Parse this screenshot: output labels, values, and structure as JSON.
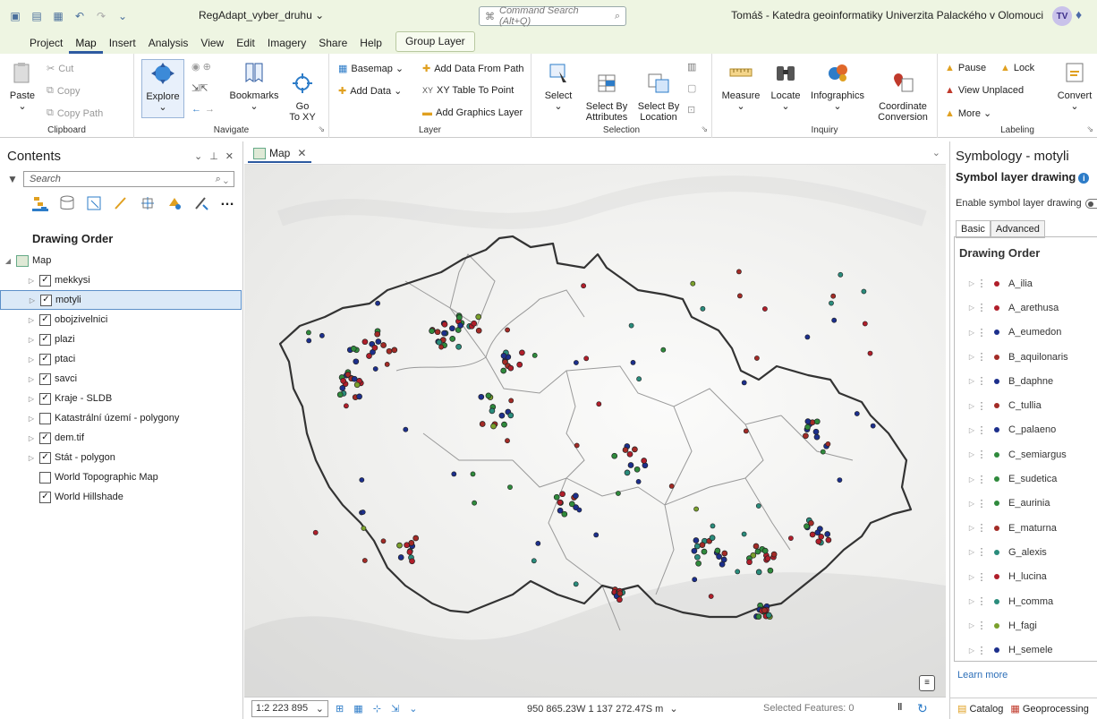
{
  "titlebar": {
    "doc_title": "RegAdapt_vyber_druhu ⌄",
    "command_search_placeholder": "Command Search (Alt+Q)",
    "user": "Tomáš - Katedra geoinformatiky Univerzita Palackého v Olomouci",
    "avatar": "TV"
  },
  "ribbon_tabs": [
    "Project",
    "Map",
    "Insert",
    "Analysis",
    "View",
    "Edit",
    "Imagery",
    "Share",
    "Help"
  ],
  "ribbon_context_tab": "Group Layer",
  "ribbon": {
    "clipboard": {
      "label": "Clipboard",
      "paste": "Paste",
      "cut": "Cut",
      "copy": "Copy",
      "copy_path": "Copy Path"
    },
    "navigate": {
      "label": "Navigate",
      "explore": "Explore",
      "bookmarks": "Bookmarks",
      "go_to_xy": "Go\nTo XY"
    },
    "layer": {
      "label": "Layer",
      "basemap": "Basemap ⌄",
      "add_data": "Add Data ⌄",
      "add_data_from_path": "Add Data From Path",
      "xy_table_to_point": "XY Table To Point",
      "add_graphics_layer": "Add Graphics Layer"
    },
    "selection": {
      "label": "Selection",
      "select": "Select",
      "select_by_attributes": "Select By\nAttributes",
      "select_by_location": "Select By\nLocation"
    },
    "inquiry": {
      "label": "Inquiry",
      "measure": "Measure",
      "locate": "Locate",
      "infographics": "Infographics",
      "coordinate_conversion": "Coordinate\nConversion"
    },
    "labeling": {
      "label": "Labeling",
      "pause": "Pause",
      "lock": "Lock",
      "view_unplaced": "View Unplaced",
      "more": "More ⌄",
      "convert": "Convert"
    }
  },
  "contents": {
    "title": "Contents",
    "search_placeholder": "Search",
    "section": "Drawing Order",
    "map_label": "Map",
    "layers": [
      {
        "name": "mekkysi",
        "checked": true,
        "expandable": true,
        "selected": false
      },
      {
        "name": "motyli",
        "checked": true,
        "expandable": true,
        "selected": true
      },
      {
        "name": "obojzivelnici",
        "checked": true,
        "expandable": true,
        "selected": false
      },
      {
        "name": "plazi",
        "checked": true,
        "expandable": true,
        "selected": false
      },
      {
        "name": "ptaci",
        "checked": true,
        "expandable": true,
        "selected": false
      },
      {
        "name": "savci",
        "checked": true,
        "expandable": true,
        "selected": false
      },
      {
        "name": "Kraje - SLDB",
        "checked": true,
        "expandable": true,
        "selected": false
      },
      {
        "name": "Katastrální území - polygony",
        "checked": false,
        "expandable": true,
        "selected": false
      },
      {
        "name": "dem.tif",
        "checked": true,
        "expandable": true,
        "selected": false
      },
      {
        "name": "Stát - polygon",
        "checked": true,
        "expandable": true,
        "selected": false
      },
      {
        "name": "World Topographic Map",
        "checked": false,
        "expandable": false,
        "selected": false
      },
      {
        "name": "World Hillshade",
        "checked": true,
        "expandable": false,
        "selected": false
      }
    ]
  },
  "map_view": {
    "tab_label": "Map",
    "scale": "1:2 223 895",
    "coordinates": "950 865.23W 1 137 272.47S m",
    "selected_features": "Selected Features: 0"
  },
  "symbology": {
    "title": "Symbology - motyli",
    "subtitle": "Symbol layer drawing",
    "enable_label": "Enable symbol layer drawing",
    "tabs": [
      "Basic",
      "Advanced"
    ],
    "section": "Drawing Order",
    "symbols": [
      {
        "name": "A_ilia",
        "color": "#b01e2a"
      },
      {
        "name": "A_arethusa",
        "color": "#b01e2a"
      },
      {
        "name": "A_eumedon",
        "color": "#1c2f8c"
      },
      {
        "name": "B_aquilonaris",
        "color": "#a32b26"
      },
      {
        "name": "B_daphne",
        "color": "#1c2f8c"
      },
      {
        "name": "C_tullia",
        "color": "#a32b26"
      },
      {
        "name": "C_palaeno",
        "color": "#1c2f8c"
      },
      {
        "name": "C_semiargus",
        "color": "#2f8a3c"
      },
      {
        "name": "E_sudetica",
        "color": "#2f8a3c"
      },
      {
        "name": "E_aurinia",
        "color": "#2f8a3c"
      },
      {
        "name": "E_maturna",
        "color": "#a32b26"
      },
      {
        "name": "G_alexis",
        "color": "#2a8c7c"
      },
      {
        "name": "H_lucina",
        "color": "#b01e2a"
      },
      {
        "name": "H_comma",
        "color": "#2a8c7c"
      },
      {
        "name": "H_fagi",
        "color": "#7aa02c"
      },
      {
        "name": "H_semele",
        "color": "#1c2f8c"
      }
    ],
    "learn_more": "Learn more",
    "bottom_tabs": [
      "Catalog",
      "Geoprocessing"
    ]
  }
}
